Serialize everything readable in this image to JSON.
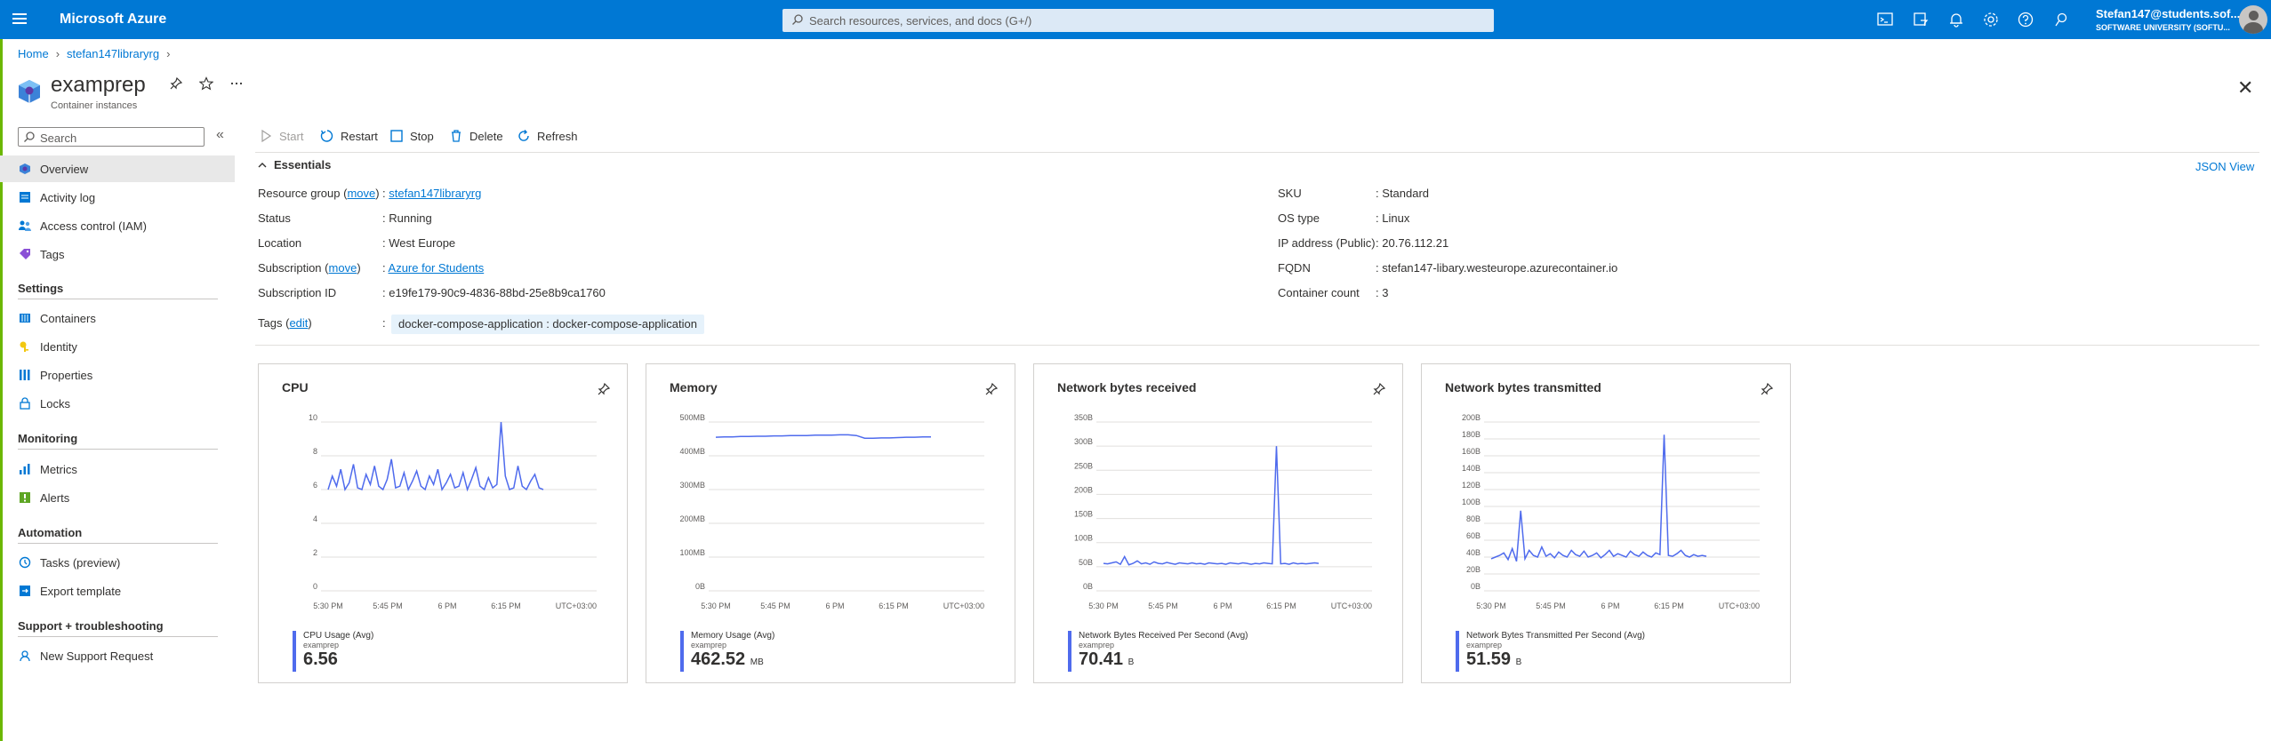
{
  "topbar": {
    "brand": "Microsoft Azure",
    "search_placeholder": "Search resources, services, and docs (G+/)",
    "user_email": "Stefan147@students.sof...",
    "user_org": "SOFTWARE UNIVERSITY (SOFTU...",
    "icons": [
      "cloud-shell-icon",
      "directory-filter-icon",
      "notifications-icon",
      "settings-icon",
      "help-icon",
      "feedback-icon"
    ]
  },
  "breadcrumb": {
    "home": "Home",
    "rg": "stefan147libraryrg"
  },
  "resource": {
    "name": "examprep",
    "type": "Container instances"
  },
  "sidebar": {
    "search_placeholder": "Search",
    "items": [
      {
        "label": "Overview"
      },
      {
        "label": "Activity log"
      },
      {
        "label": "Access control (IAM)"
      },
      {
        "label": "Tags"
      }
    ],
    "groups": [
      {
        "title": "Settings",
        "items": [
          {
            "label": "Containers"
          },
          {
            "label": "Identity"
          },
          {
            "label": "Properties"
          },
          {
            "label": "Locks"
          }
        ]
      },
      {
        "title": "Monitoring",
        "items": [
          {
            "label": "Metrics"
          },
          {
            "label": "Alerts"
          }
        ]
      },
      {
        "title": "Automation",
        "items": [
          {
            "label": "Tasks (preview)"
          },
          {
            "label": "Export template"
          }
        ]
      },
      {
        "title": "Support + troubleshooting",
        "items": [
          {
            "label": "New Support Request"
          }
        ]
      }
    ]
  },
  "commands": {
    "start": "Start",
    "restart": "Restart",
    "stop": "Stop",
    "delete": "Delete",
    "refresh": "Refresh"
  },
  "essentials": {
    "title": "Essentials",
    "json_view": "JSON View",
    "left": {
      "resource_group_label": "Resource group",
      "move": "move",
      "resource_group_value": "stefan147libraryrg",
      "status_label": "Status",
      "status_value": "Running",
      "location_label": "Location",
      "location_value": "West Europe",
      "subscription_label": "Subscription",
      "subscription_value": "Azure for Students",
      "subscription_id_label": "Subscription ID",
      "subscription_id_value": "e19fe179-90c9-4836-88bd-25e8b9ca1760",
      "tags_label": "Tags",
      "edit": "edit",
      "tag_value": "docker-compose-application : docker-compose-application"
    },
    "right": {
      "sku_label": "SKU",
      "sku_value": "Standard",
      "os_label": "OS type",
      "os_value": "Linux",
      "ip_label": "IP address (Public)",
      "ip_value": "20.76.112.21",
      "fqdn_label": "FQDN",
      "fqdn_value": "stefan147-libary.westeurope.azurecontainer.io",
      "count_label": "Container count",
      "count_value": "3"
    }
  },
  "chart_data": [
    {
      "type": "line",
      "title": "CPU",
      "x_ticks": [
        "5:30 PM",
        "5:45 PM",
        "6 PM",
        "6:15 PM",
        "UTC+03:00"
      ],
      "y_ticks": [
        "0",
        "2",
        "4",
        "6",
        "8",
        "10"
      ],
      "ylim": [
        0,
        10
      ],
      "series": [
        {
          "name": "CPU Usage (Avg)",
          "values": [
            6.0,
            6.8,
            6.2,
            7.2,
            6.0,
            6.4,
            7.5,
            6.1,
            6.0,
            6.9,
            6.3,
            7.4,
            6.2,
            6.0,
            6.6,
            7.8,
            6.1,
            6.2,
            7.0,
            6.0,
            6.5,
            7.1,
            6.2,
            6.0,
            6.8,
            6.3,
            7.2,
            6.0,
            6.4,
            6.9,
            6.1,
            6.2,
            7.0,
            6.0,
            6.6,
            7.3,
            6.2,
            6.0,
            6.7,
            6.1,
            6.3,
            10.0,
            6.8,
            6.0,
            6.1,
            7.4,
            6.2,
            6.0,
            6.5,
            6.9,
            6.1,
            6.0
          ]
        }
      ],
      "legend": {
        "label": "CPU Usage (Avg)",
        "resource": "examprep",
        "value": "6.56",
        "unit": ""
      }
    },
    {
      "type": "line",
      "title": "Memory",
      "x_ticks": [
        "5:30 PM",
        "5:45 PM",
        "6 PM",
        "6:15 PM",
        "UTC+03:00"
      ],
      "y_ticks": [
        "0B",
        "100MB",
        "200MB",
        "300MB",
        "400MB",
        "500MB"
      ],
      "ylim": [
        0,
        500
      ],
      "series": [
        {
          "name": "Memory Usage (Avg)",
          "values": [
            455,
            456,
            456,
            457,
            457,
            458,
            458,
            459,
            459,
            460,
            460,
            460,
            461,
            461,
            461,
            462,
            462,
            460,
            452,
            452,
            453,
            453,
            454,
            455,
            455,
            456,
            456
          ]
        }
      ],
      "legend": {
        "label": "Memory Usage (Avg)",
        "resource": "examprep",
        "value": "462.52",
        "unit": "MB"
      }
    },
    {
      "type": "line",
      "title": "Network bytes received",
      "x_ticks": [
        "5:30 PM",
        "5:45 PM",
        "6 PM",
        "6:15 PM",
        "UTC+03:00"
      ],
      "y_ticks": [
        "0B",
        "50B",
        "100B",
        "150B",
        "200B",
        "250B",
        "300B",
        "350B"
      ],
      "ylim": [
        0,
        350
      ],
      "series": [
        {
          "name": "Network Bytes Received Per Second (Avg)",
          "values": [
            57,
            56,
            58,
            60,
            55,
            71,
            54,
            57,
            62,
            56,
            58,
            55,
            60,
            57,
            56,
            59,
            57,
            55,
            58,
            57,
            56,
            58,
            56,
            57,
            55,
            58,
            57,
            56,
            57,
            55,
            58,
            57,
            56,
            58,
            57,
            55,
            57,
            56,
            58,
            57,
            56,
            300,
            56,
            57,
            55,
            58,
            56,
            57,
            56,
            57,
            58,
            57
          ]
        }
      ],
      "legend": {
        "label": "Network Bytes Received Per Second (Avg)",
        "resource": "examprep",
        "value": "70.41",
        "unit": "B"
      }
    },
    {
      "type": "line",
      "title": "Network bytes transmitted",
      "x_ticks": [
        "5:30 PM",
        "5:45 PM",
        "6 PM",
        "6:15 PM",
        "UTC+03:00"
      ],
      "y_ticks": [
        "0B",
        "20B",
        "40B",
        "60B",
        "80B",
        "100B",
        "120B",
        "140B",
        "160B",
        "180B",
        "200B"
      ],
      "ylim": [
        0,
        200
      ],
      "series": [
        {
          "name": "Network Bytes Transmitted Per Second (Avg)",
          "values": [
            38,
            40,
            42,
            45,
            37,
            50,
            35,
            95,
            38,
            48,
            42,
            40,
            52,
            41,
            44,
            39,
            46,
            42,
            40,
            48,
            43,
            41,
            47,
            40,
            42,
            45,
            39,
            43,
            48,
            41,
            44,
            42,
            40,
            47,
            43,
            41,
            46,
            42,
            40,
            45,
            43,
            185,
            42,
            41,
            44,
            48,
            42,
            40,
            43,
            41,
            42,
            41
          ]
        }
      ],
      "legend": {
        "label": "Network Bytes Transmitted Per Second (Avg)",
        "resource": "examprep",
        "value": "51.59",
        "unit": "B"
      }
    }
  ]
}
